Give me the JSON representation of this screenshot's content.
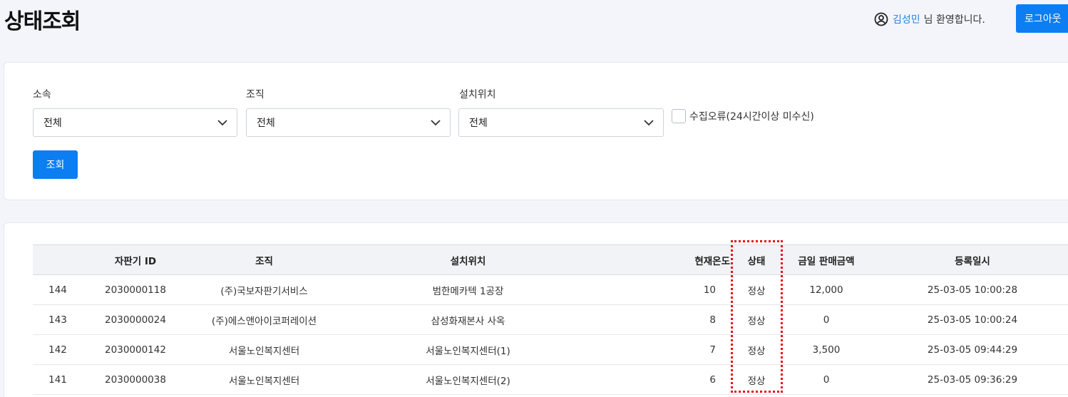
{
  "header": {
    "title": "상태조회",
    "user_name": "김성민",
    "welcome_suffix": "님 환영합니다.",
    "logout_label": "로그아웃"
  },
  "filters": {
    "affiliation": {
      "label": "소속",
      "value": "전체"
    },
    "organization": {
      "label": "조직",
      "value": "전체"
    },
    "location": {
      "label": "설치위치",
      "value": "전체"
    },
    "collect_error_label": "수집오류(24시간이상 미수신)",
    "collect_error_checked": false,
    "search_label": "조회"
  },
  "table": {
    "headers": [
      "",
      "자판기 ID",
      "조직",
      "설치위치",
      "현재온도",
      "상태",
      "금일 판매금액",
      "등록일시"
    ],
    "rows": [
      [
        "144",
        "2030000118",
        "(주)국보자판기서비스",
        "범한메카텍 1공장",
        "10",
        "정상",
        "12,000",
        "25-03-05 10:00:28"
      ],
      [
        "143",
        "2030000024",
        "(주)에스앤아이코퍼레이션",
        "삼성화재본사 사옥",
        "8",
        "정상",
        "0",
        "25-03-05 10:00:24"
      ],
      [
        "142",
        "2030000142",
        "서울노인복지센터",
        "서울노인복지센터(1)",
        "7",
        "정상",
        "3,500",
        "25-03-05 09:44:29"
      ],
      [
        "141",
        "2030000038",
        "서울노인복지센터",
        "서울노인복지센터(2)",
        "6",
        "정상",
        "0",
        "25-03-05 09:36:29"
      ]
    ]
  },
  "colors": {
    "accent": "#0d7ef2",
    "highlight": "#e8101a",
    "user_name": "#2a7fe0"
  },
  "icons": {
    "user": "user-circle-icon",
    "dropdown": "chevron-down-icon"
  }
}
